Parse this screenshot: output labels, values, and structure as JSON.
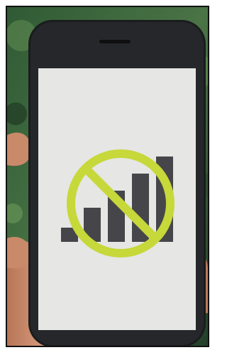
{
  "photo": {
    "subject": "no-signal-icon",
    "colors": {
      "background_foliage": "#3f6a3f",
      "background_dark": "#1f3a22",
      "phone_body": "#1b1c1e",
      "screen": "#e6e6e4",
      "bars": "#46464a",
      "prohibition_ring": "#c6d83a",
      "skin": "#c98a6a",
      "skin_shadow": "#9f624a"
    },
    "signal_bars_count": 5
  }
}
